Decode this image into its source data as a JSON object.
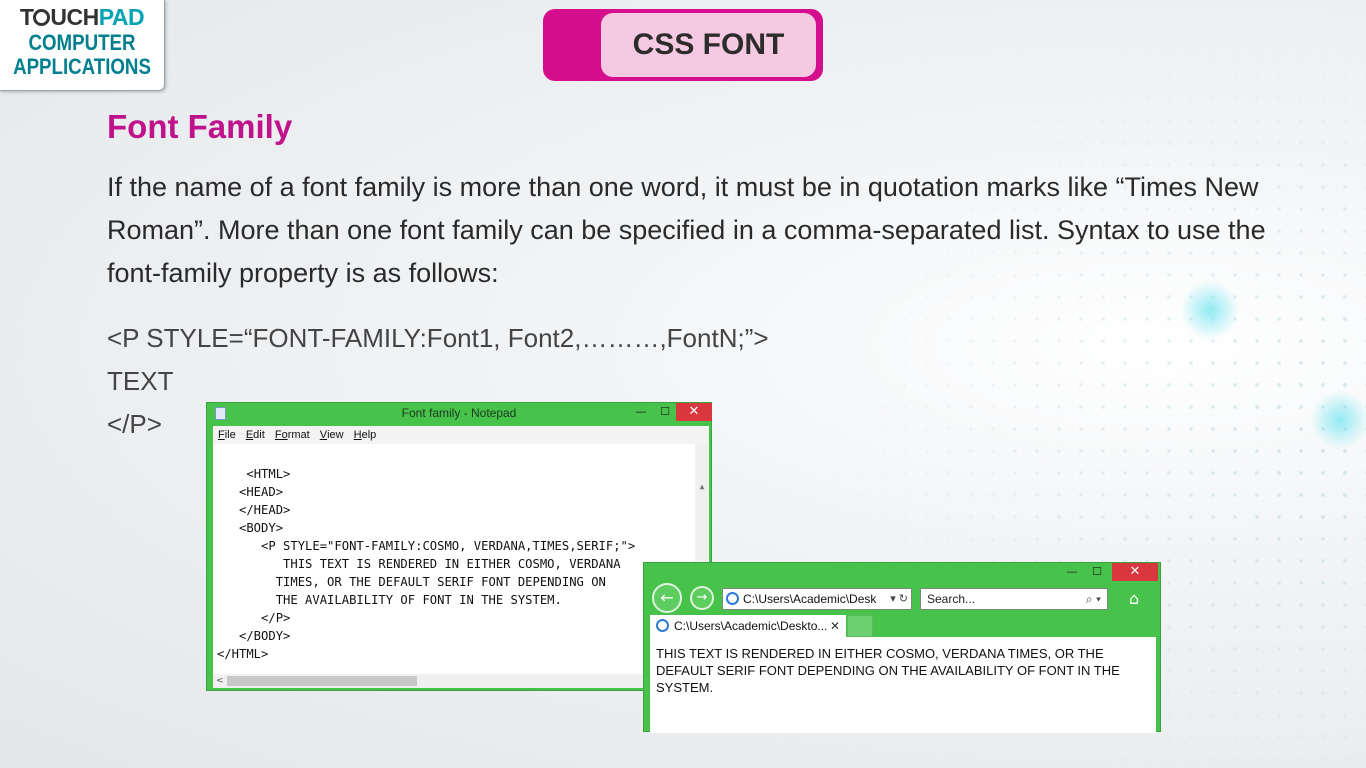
{
  "logo": {
    "brand_pre": "T",
    "brand_mid": "UCH",
    "brand_pad": "PAD",
    "line1": "COMPUTER",
    "line2": "APPLICATIONS"
  },
  "header": {
    "title": "CSS FONT"
  },
  "heading": "Font Family",
  "paragraph": "If the name of a font family is more than one word, it must be in quotation marks like “Times New Roman”. More than one font family can be specified in a comma-separated list. Syntax to use the font-family property is as follows:",
  "syntax": {
    "line1": "<P STYLE=“FONT-FAMILY:Font1, Font2,………,FontN;”>",
    "line2": "TEXT",
    "line3": "</P>"
  },
  "notepad": {
    "title": "Font family - Notepad",
    "window_controls": {
      "minimize": "—",
      "maximize": "☐",
      "close": "✕"
    },
    "menu": [
      {
        "key": "F",
        "rest": "ile"
      },
      {
        "key": "E",
        "rest": "dit"
      },
      {
        "key": "Fo",
        "rest": "rmat"
      },
      {
        "key": "V",
        "rest": "iew"
      },
      {
        "key": "H",
        "rest": "elp"
      }
    ],
    "content": "<HTML>\n   <HEAD>\n   </HEAD>\n   <BODY>\n      <P STYLE=\"FONT-FAMILY:COSMO, VERDANA,TIMES,SERIF;\">\n         THIS TEXT IS RENDERED IN EITHER COSMO, VERDANA\n        TIMES, OR THE DEFAULT SERIF FONT DEPENDING ON\n        THE AVAILABILITY OF FONT IN THE SYSTEM.\n      </P>\n   </BODY>\n</HTML>"
  },
  "browser": {
    "window_controls": {
      "minimize": "—",
      "maximize": "☐",
      "close": "✕"
    },
    "address": "C:\\Users\\Academic\\Desk",
    "address_tail": "▾ ↻",
    "search_placeholder": "Search...",
    "search_tail": "⌕ ▾",
    "tab_label": "C:\\Users\\Academic\\Deskto...",
    "tab_close": "✕",
    "content": "THIS TEXT IS RENDERED IN EITHER COSMO, VERDANA TIMES, OR THE DEFAULT SERIF FONT DEPENDING ON THE AVAILABILITY OF FONT IN THE SYSTEM."
  },
  "icons": {
    "back": "←",
    "forward": "→",
    "home": "⌂",
    "scroll_up": "▲",
    "scroll_left": "<"
  }
}
